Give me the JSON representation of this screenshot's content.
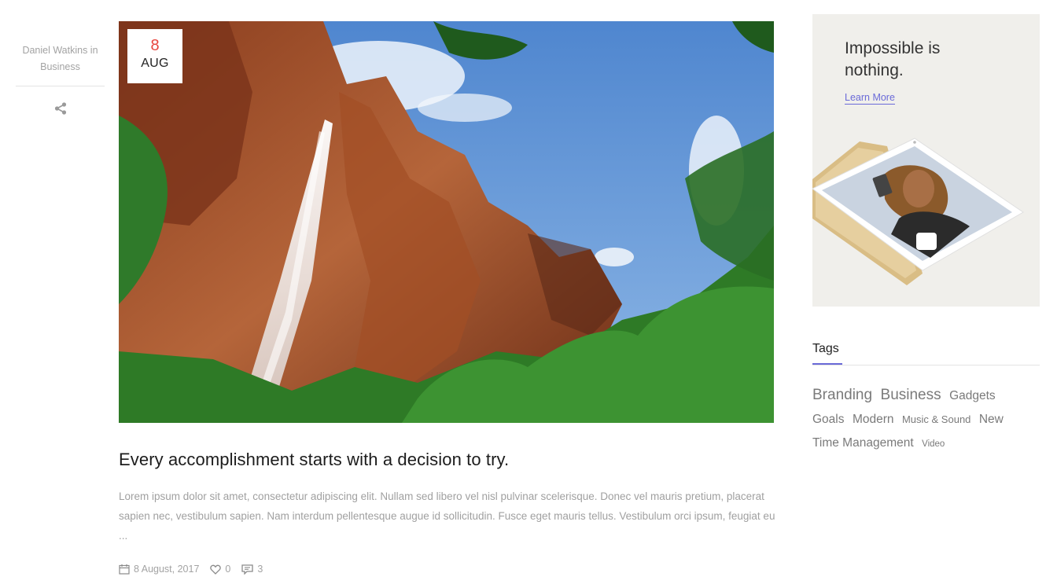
{
  "post": {
    "author_line": "Daniel Watkins in Business",
    "date_day": "8",
    "date_month": "AUG",
    "title": "Every accomplishment starts with a decision to try.",
    "excerpt": "Lorem ipsum dolor sit amet, consectetur adipiscing elit. Nullam sed libero vel nisl pulvinar scelerisque. Donec vel mauris pretium, placerat sapien nec, vestibulum sapien. Nam interdum pellentesque augue id sollicitudin. Fusce eget mauris tellus. Vestibulum orci ipsum, feugiat eu ...",
    "meta": {
      "date": "8 August, 2017",
      "likes": "0",
      "comments": "3"
    }
  },
  "promo": {
    "title": "Impossible is nothing.",
    "link": "Learn More"
  },
  "tags": {
    "heading": "Tags",
    "items": [
      {
        "label": "Branding",
        "size": "lg"
      },
      {
        "label": "Business",
        "size": "lg"
      },
      {
        "label": "Gadgets",
        "size": "md"
      },
      {
        "label": "Goals",
        "size": "md"
      },
      {
        "label": "Modern",
        "size": "md"
      },
      {
        "label": "Music & Sound",
        "size": "sm"
      },
      {
        "label": "New",
        "size": "md"
      },
      {
        "label": "Time Management",
        "size": "md"
      },
      {
        "label": "Video",
        "size": "xs"
      }
    ]
  },
  "colors": {
    "accent": "#6a6ad8",
    "date_red": "#e8463e",
    "muted_text": "#a0a0a0"
  }
}
